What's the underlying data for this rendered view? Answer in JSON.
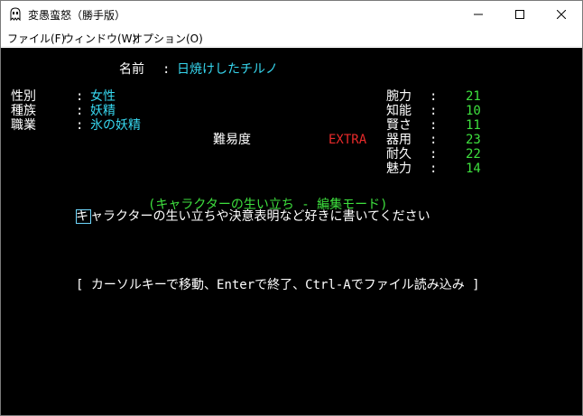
{
  "window": {
    "title": "変愚蛮怒（勝手版）",
    "icon": "ghost-app-icon"
  },
  "menu": {
    "file": "ファイル(F)",
    "window": "ウィンドウ(W)",
    "options": "オプション(O)"
  },
  "character": {
    "name_label": "名前",
    "name_sep": ":",
    "name": "日焼けしたチルノ",
    "sex_label": "性別",
    "sex": "女性",
    "race_label": "種族",
    "race": "妖精",
    "class_label": "職業",
    "class": "氷の妖精",
    "field_sep": ":",
    "difficulty_label": "難易度",
    "difficulty": "EXTRA"
  },
  "stats": [
    {
      "label": "腕力",
      "sep": ":",
      "value": "21"
    },
    {
      "label": "知能",
      "sep": ":",
      "value": "10"
    },
    {
      "label": "賢さ",
      "sep": ":",
      "value": "11"
    },
    {
      "label": "器用",
      "sep": ":",
      "value": "23"
    },
    {
      "label": "耐久",
      "sep": ":",
      "value": "22"
    },
    {
      "label": "魅力",
      "sep": ":",
      "value": "14"
    }
  ],
  "editor": {
    "heading": "(キャラクターの生い立ち - 編集モード)",
    "cursor_char": "キ",
    "text_rest": "ャラクターの生い立ちや決意表明など好きに書いてください",
    "help": "[ カーソルキーで移動、Enterで終了、Ctrl-Aでファイル読み込み ]"
  },
  "colors": {
    "background": "#000000",
    "text": "#ffffff",
    "value": "#37d8f0",
    "stat_value": "#3ee03e",
    "difficulty": "#e82a2a"
  }
}
